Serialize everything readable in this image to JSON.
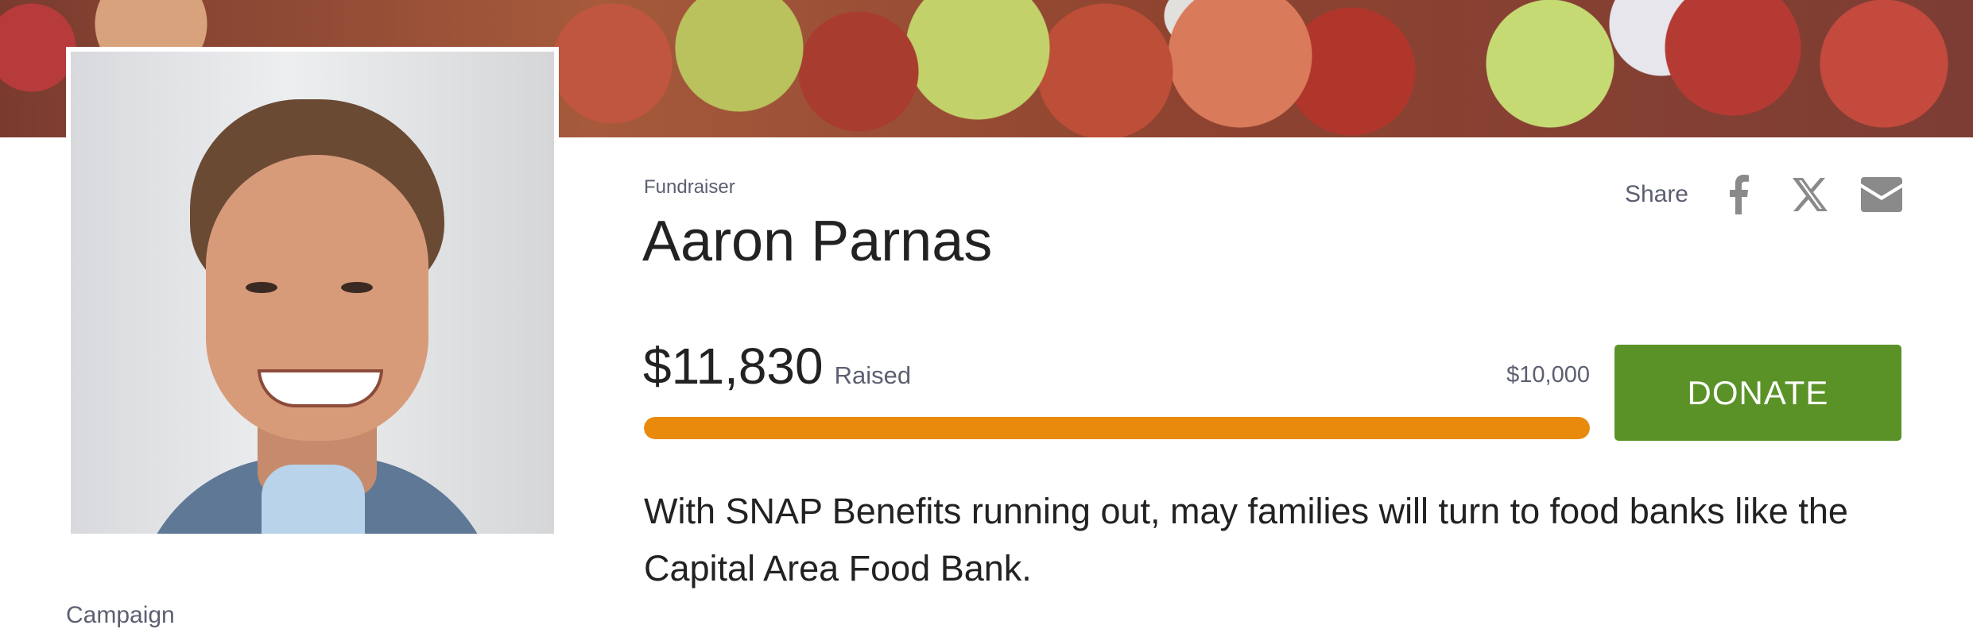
{
  "fundraiser": {
    "eyebrow": "Fundraiser",
    "title": "Aaron Parnas",
    "raised_amount": "$11,830",
    "raised_label": "Raised",
    "goal_amount": "$10,000",
    "progress_percent": 100,
    "donate_label": "DONATE",
    "description": "With SNAP Benefits running out, may families will turn to food banks like the Capital Area Food Bank."
  },
  "share": {
    "label": "Share",
    "icons": [
      "facebook-icon",
      "x-icon",
      "email-icon"
    ]
  },
  "sidebar": {
    "campaign_label": "Campaign"
  },
  "colors": {
    "progress_fill": "#e98a0d",
    "donate_button": "#5a9228"
  }
}
